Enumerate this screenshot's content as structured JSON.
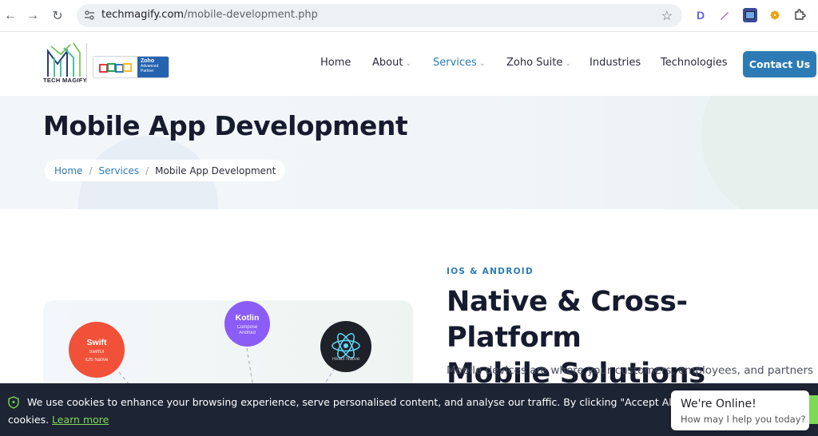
{
  "browser": {
    "url_domain": "techmagify.com",
    "url_path": "/mobile-development.php",
    "extensions": [
      "D",
      "",
      "",
      "",
      ""
    ]
  },
  "header": {
    "logo_text": "TECH MAGIFY",
    "zoho_badge": {
      "title": "Zoho",
      "subtitle": "Advanced Partner"
    },
    "nav": [
      {
        "label": "Home"
      },
      {
        "label": "About"
      },
      {
        "label": "Services"
      },
      {
        "label": "Zoho Suite"
      },
      {
        "label": "Industries"
      },
      {
        "label": "Technologies"
      }
    ],
    "contact_label": "Contact Us"
  },
  "hero": {
    "title": "Mobile App Development",
    "breadcrumb": {
      "home": "Home",
      "services": "Services",
      "current": "Mobile App Development"
    }
  },
  "content": {
    "eyebrow": "IOS & ANDROID",
    "headline_line1": "Native & Cross-Platform",
    "headline_line2": "Mobile Solutions",
    "body": "Mobile devices are where your customers, employees, and partners"
  },
  "illustration": {
    "swift": {
      "title": "Swift",
      "line1": "SwiftUI",
      "line2": "iOS Native"
    },
    "kotlin": {
      "title": "Kotlin",
      "line1": "Compose",
      "line2": "Android"
    },
    "react": {
      "label": "React Native"
    }
  },
  "cookie": {
    "text1": "We use cookies to enhance your browsing experience, serve personalised content, and analyse our traffic. By clicking \"Accept All\", you consent to our use of",
    "text2": "cookies.",
    "link": "Learn more"
  },
  "chat": {
    "title": "We're Online!",
    "subtitle": "How may I help you today?"
  },
  "colors": {
    "accent": "#2d7bb5",
    "dark": "#161b2e",
    "cookie_bg": "#1d2433",
    "cookie_link": "#7ed957",
    "swift": "#f05138",
    "kotlin": "#8b5cf6",
    "react": "#1e2128"
  }
}
